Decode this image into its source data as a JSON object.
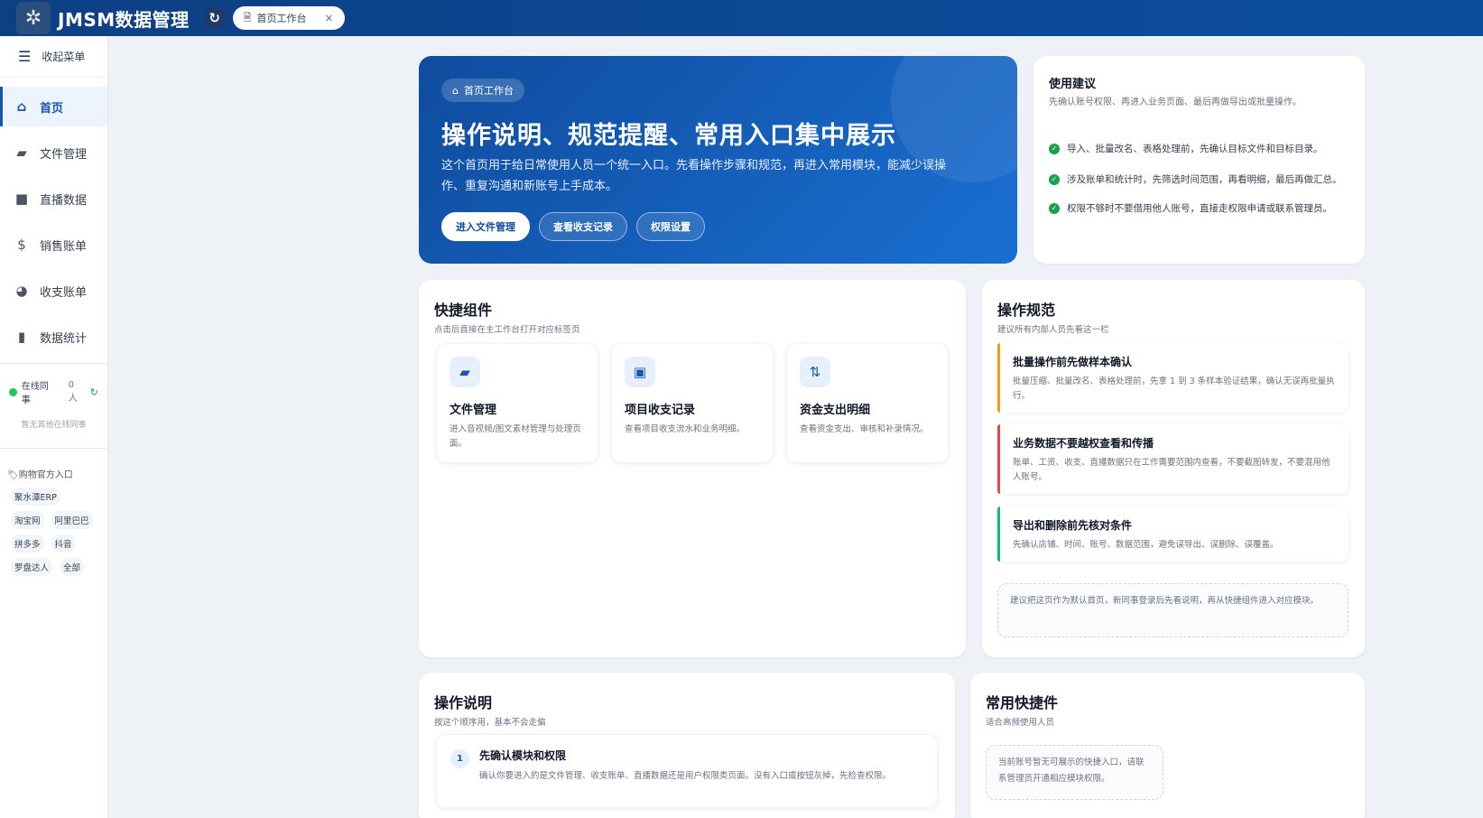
{
  "app": {
    "title": "JMSM数据管理",
    "logo_glyph": "✲"
  },
  "tabs": [
    {
      "label": "首页工作台"
    }
  ],
  "sidebar": {
    "collapse_label": "收起菜单",
    "items": [
      {
        "label": "首页",
        "icon": "home-icon",
        "active": true
      },
      {
        "label": "文件管理",
        "icon": "folder-icon"
      },
      {
        "label": "直播数据",
        "icon": "video-icon"
      },
      {
        "label": "销售账单",
        "icon": "invoice-icon"
      },
      {
        "label": "收支账单",
        "icon": "pie-icon"
      },
      {
        "label": "数据统计",
        "icon": "bar-chart-icon"
      }
    ],
    "online": {
      "label": "在线同事",
      "count": "0 人",
      "empty": "暂无其他在线同事"
    },
    "shop_title": "购物官方入口",
    "shops": [
      "聚水潭ERP",
      "淘宝网",
      "阿里巴巴",
      "拼多多",
      "抖音",
      "罗盘达人",
      "全部"
    ]
  },
  "hero": {
    "badge": "首页工作台",
    "title": "操作说明、规范提醒、常用入口集中展示",
    "desc": "这个首页用于给日常使用人员一个统一入口。先看操作步骤和规范，再进入常用模块，能减少误操作、重复沟通和新账号上手成本。",
    "buttons": [
      "进入文件管理",
      "查看收支记录",
      "权限设置"
    ]
  },
  "tips": {
    "title": "使用建议",
    "subtitle": "先确认账号权限、再进入业务页面、最后再做导出或批量操作。",
    "items": [
      "导入、批量改名、表格处理前，先确认目标文件和目标目录。",
      "涉及账单和统计时，先筛选时间范围，再看明细，最后再做汇总。",
      "权限不够时不要借用他人账号，直接走权限申请或联系管理员。"
    ]
  },
  "quick": {
    "title": "快捷组件",
    "subtitle": "点击后直接在主工作台打开对应标签页",
    "items": [
      {
        "title": "文件管理",
        "desc": "进入音视频/图文素材管理与处理页面。",
        "icon": "folder-icon"
      },
      {
        "title": "项目收支记录",
        "desc": "查看项目收支流水和业务明细。",
        "icon": "money-icon"
      },
      {
        "title": "资金支出明细",
        "desc": "查看资金支出、审核和补录情况。",
        "icon": "sort-icon"
      }
    ]
  },
  "norms": {
    "title": "操作规范",
    "subtitle": "建议所有内部人员先看这一栏",
    "items": [
      {
        "title": "批量操作前先做样本确认",
        "desc": "批量压缩、批量改名、表格处理前，先拿 1 到 3 条样本验证结果，确认无误再批量执行。",
        "color": "#f59e0b"
      },
      {
        "title": "业务数据不要越权查看和传播",
        "desc": "账单、工资、收支、直播数据只在工作需要范围内查看，不要截图转发，不要混用他人账号。",
        "color": "#ef4444"
      },
      {
        "title": "导出和删除前先核对条件",
        "desc": "先确认店铺、时间、账号、数据范围，避免误导出、误删除、误覆盖。",
        "color": "#10b981"
      }
    ],
    "note": "建议把这页作为默认首页，新同事登录后先看说明，再从快捷组件进入对应模块。"
  },
  "instructions": {
    "title": "操作说明",
    "subtitle": "按这个顺序用，基本不会走偏",
    "steps": [
      {
        "num": "1",
        "title": "先确认模块和权限",
        "desc": "确认你要进入的是文件管理、收支账单、直播数据还是用户权限类页面。没有入口或按钮灰掉，先检查权限。"
      }
    ]
  },
  "common": {
    "title": "常用快捷件",
    "subtitle": "适合高频使用人员",
    "empty": "当前账号暂无可展示的快捷入口，请联系管理员开通相应模块权限。"
  }
}
